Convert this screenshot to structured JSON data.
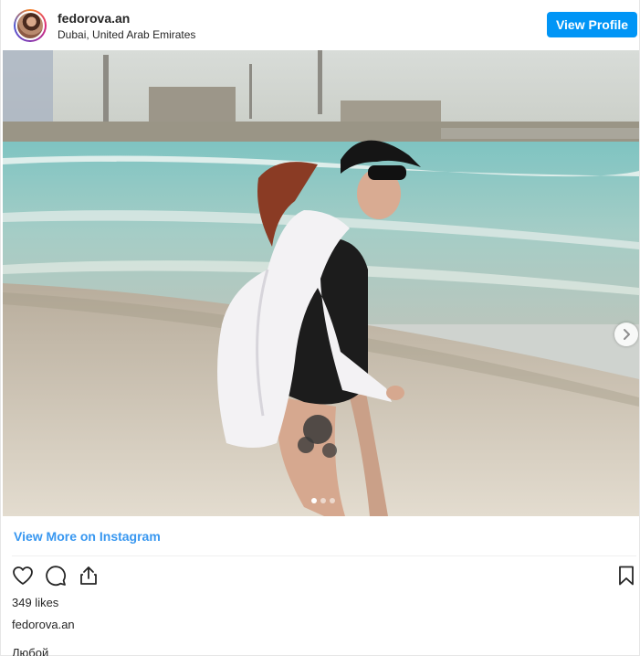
{
  "header": {
    "username": "fedorova.an",
    "location": "Dubai, United Arab Emirates",
    "view_profile_label": "View Profile"
  },
  "photo": {
    "subject": "beach-photo",
    "carousel_total": 3,
    "carousel_index": 1
  },
  "footer": {
    "view_more_label": "View More on Instagram",
    "likes_text": "349 likes",
    "owner_username": "fedorova.an",
    "caption_partial": "Любой"
  },
  "colors": {
    "brand_blue": "#0095f6",
    "link_blue": "#3897f0",
    "text": "#262626"
  },
  "icons": [
    "heart-icon",
    "comment-icon",
    "share-icon",
    "bookmark-icon",
    "chevron-right-icon"
  ]
}
